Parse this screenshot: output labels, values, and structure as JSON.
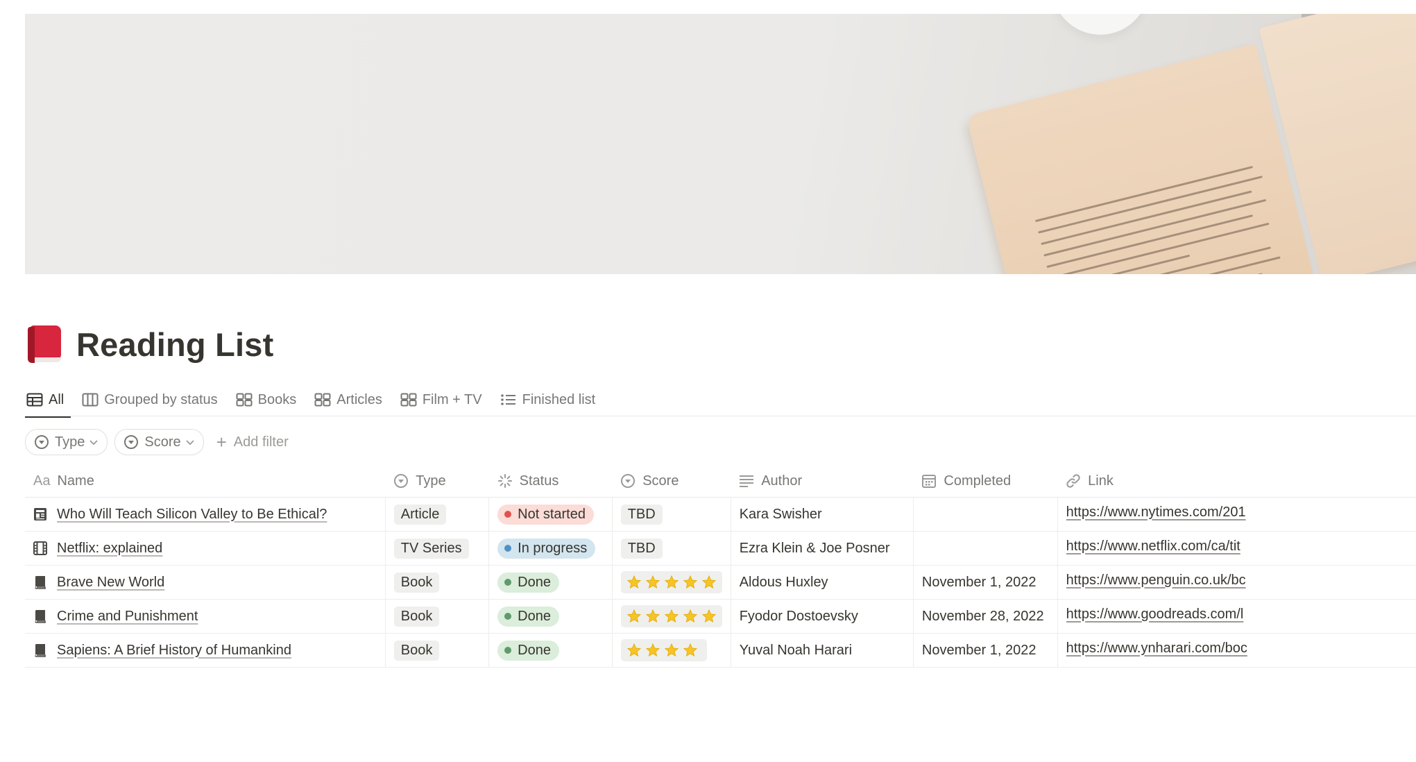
{
  "page": {
    "title": "Reading List",
    "icon": "red-book-icon"
  },
  "tabs": [
    {
      "label": "All",
      "icon": "table-icon",
      "active": true
    },
    {
      "label": "Grouped by status",
      "icon": "board-icon"
    },
    {
      "label": "Books",
      "icon": "gallery-icon"
    },
    {
      "label": "Articles",
      "icon": "gallery-icon"
    },
    {
      "label": "Film + TV",
      "icon": "gallery-icon"
    },
    {
      "label": "Finished list",
      "icon": "list-icon"
    }
  ],
  "filters": {
    "chips": [
      {
        "label": "Type",
        "icon": "select-icon"
      },
      {
        "label": "Score",
        "icon": "select-icon"
      }
    ],
    "add_label": "Add filter"
  },
  "columns": {
    "name": {
      "prefix": "Aa",
      "label": "Name"
    },
    "type": {
      "label": "Type",
      "icon": "select-icon"
    },
    "status": {
      "label": "Status",
      "icon": "status-icon"
    },
    "score": {
      "label": "Score",
      "icon": "select-icon"
    },
    "author": {
      "label": "Author",
      "icon": "text-icon"
    },
    "completed": {
      "label": "Completed",
      "icon": "calendar-icon"
    },
    "link": {
      "label": "Link",
      "icon": "link-icon"
    }
  },
  "rows": [
    {
      "icon": "article-icon",
      "name": "Who Will Teach Silicon Valley to Be Ethical?",
      "type": "Article",
      "status": "Not started",
      "score": "TBD",
      "stars": 0,
      "author": "Kara Swisher",
      "completed": "",
      "link": "https://www.nytimes.com/201"
    },
    {
      "icon": "film-icon",
      "name": "Netflix: explained",
      "type": "TV Series",
      "status": "In progress",
      "score": "TBD",
      "stars": 0,
      "author": "Ezra Klein & Joe Posner",
      "completed": "",
      "link": "https://www.netflix.com/ca/tit"
    },
    {
      "icon": "book-icon",
      "name": "Brave New World",
      "type": "Book",
      "status": "Done",
      "score": "",
      "stars": 5,
      "author": "Aldous Huxley",
      "completed": "November 1, 2022",
      "link": "https://www.penguin.co.uk/bc"
    },
    {
      "icon": "book-icon",
      "name": "Crime and Punishment",
      "type": "Book",
      "status": "Done",
      "score": "",
      "stars": 5,
      "author": "Fyodor Dostoevsky",
      "completed": "November 28, 2022",
      "link": "https://www.goodreads.com/l"
    },
    {
      "icon": "book-icon",
      "name": "Sapiens: A Brief History of Humankind",
      "type": "Book",
      "status": "Done",
      "score": "",
      "stars": 4,
      "author": "Yuval Noah Harari",
      "completed": "November 1, 2022",
      "link": "https://www.ynharari.com/boc"
    }
  ],
  "colors": {
    "not_started_bg": "#fbdcd7",
    "not_started_dot": "#e0524d",
    "in_progress_bg": "#d3e5ef",
    "in_progress_dot": "#4f91c3",
    "done_bg": "#dbeddb",
    "done_dot": "#5f9a6b",
    "star": "#f7c325",
    "tag_bg": "#efefed"
  }
}
